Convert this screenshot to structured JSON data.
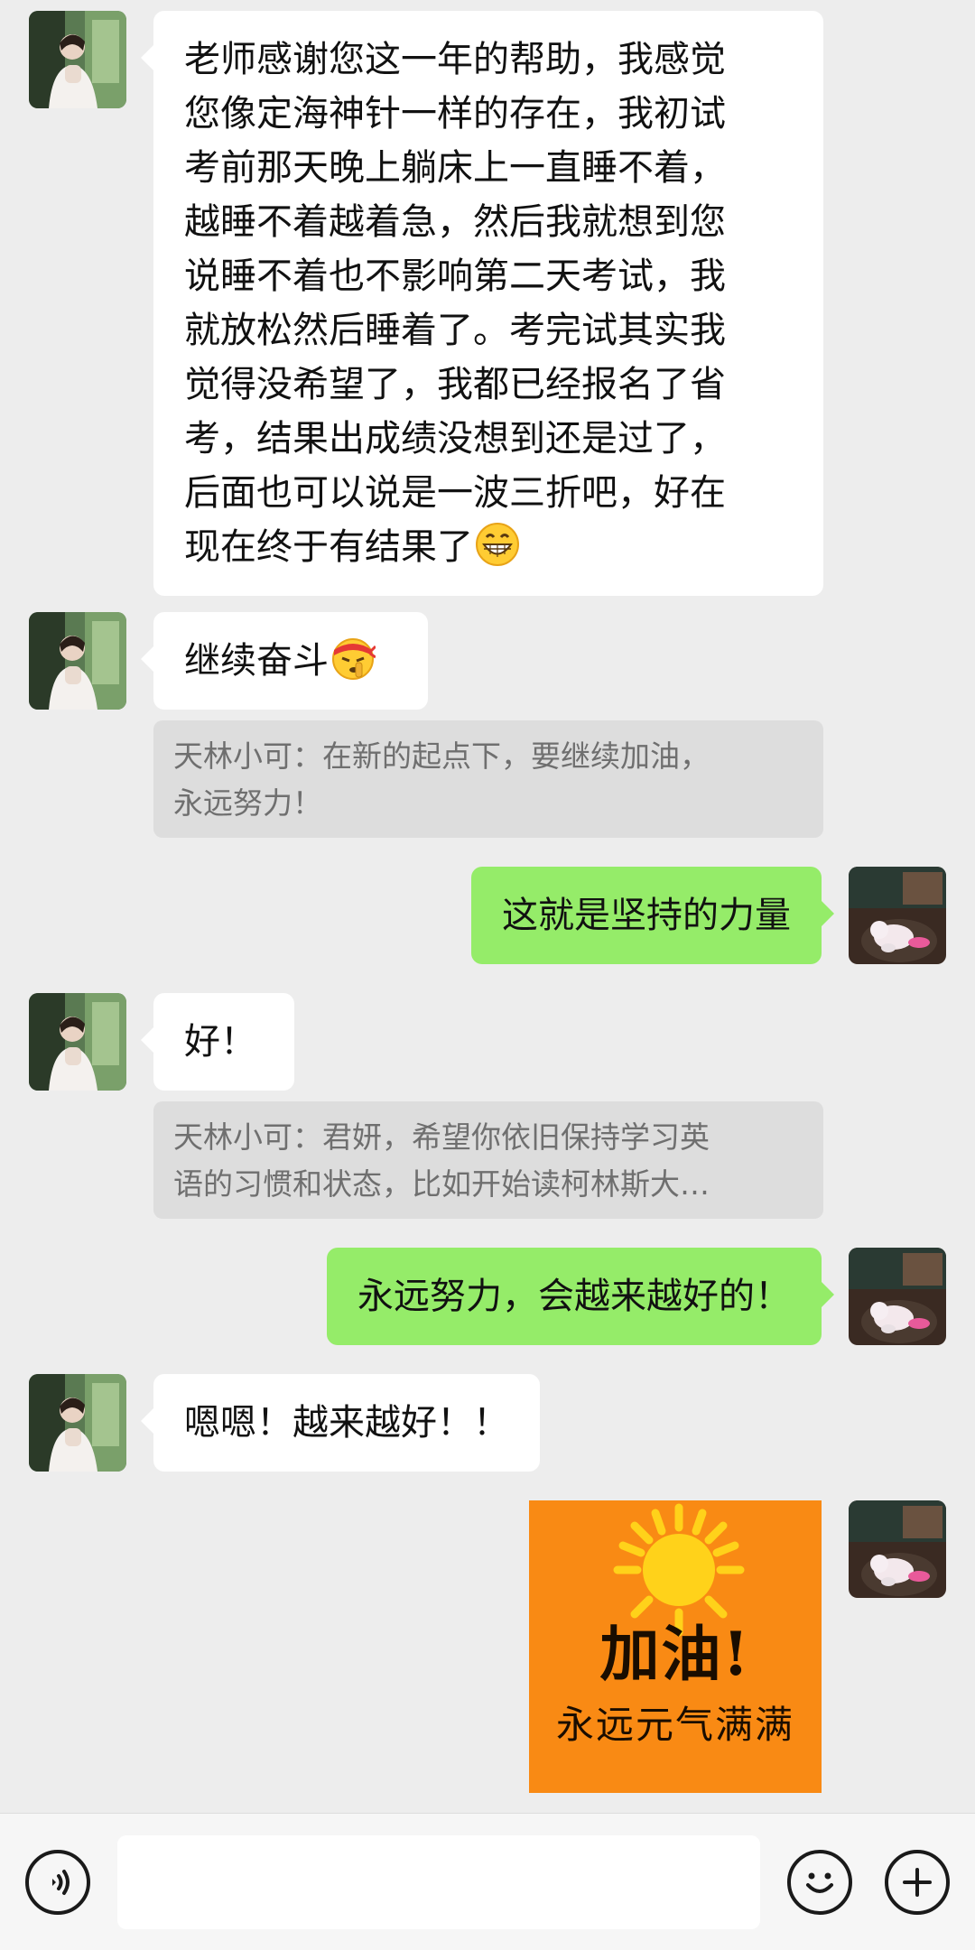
{
  "chat": {
    "messages": [
      {
        "side": "in",
        "lines": [
          "老师感谢您这一年的帮助，我感觉",
          "您像定海神针一样的存在，我初试",
          "考前那天晚上躺床上一直睡不着，",
          "越睡不着越着急，然后我就想到您",
          "说睡不着也不影响第二天考试，我",
          "就放松然后睡着了。考完试其实我",
          "觉得没希望了，我都已经报名了省",
          "考，结果出成绩没想到还是过了，",
          "后面也可以说是一波三折吧，好在",
          "现在终于有结果了"
        ],
        "emoji": "grinning-face-emoji"
      },
      {
        "side": "in",
        "text": "继续奋斗",
        "emoji": "headband-shush-face-emoji"
      },
      {
        "quote_lines": [
          "天林小可：在新的起点下，要继续加油，",
          "永远努力！"
        ]
      },
      {
        "side": "out",
        "text": "这就是坚持的力量"
      },
      {
        "side": "in",
        "text": "好！"
      },
      {
        "quote_lines": [
          "天林小可：君妍，希望你依旧保持学习英",
          "语的习惯和状态，比如开始读柯林斯大…"
        ]
      },
      {
        "side": "out",
        "text": "永远努力，会越来越好的！"
      },
      {
        "side": "in",
        "text": "嗯嗯！越来越好！！"
      },
      {
        "side": "out",
        "sticker": {
          "title": "加油!",
          "subtitle": "永远元气满满",
          "bg_color": "#f98a14",
          "sun_color": "#ffd21a"
        }
      }
    ]
  },
  "input_bar": {
    "voice_icon": "voice-icon",
    "emoji_icon": "emoji-icon",
    "plus_icon": "plus-icon",
    "input_value": "",
    "input_placeholder": ""
  },
  "colors": {
    "background": "#ededed",
    "incoming_bubble": "#ffffff",
    "outgoing_bubble": "#95ec69",
    "quote_bg": "#dddddd",
    "quote_text": "#6f6f6f"
  }
}
